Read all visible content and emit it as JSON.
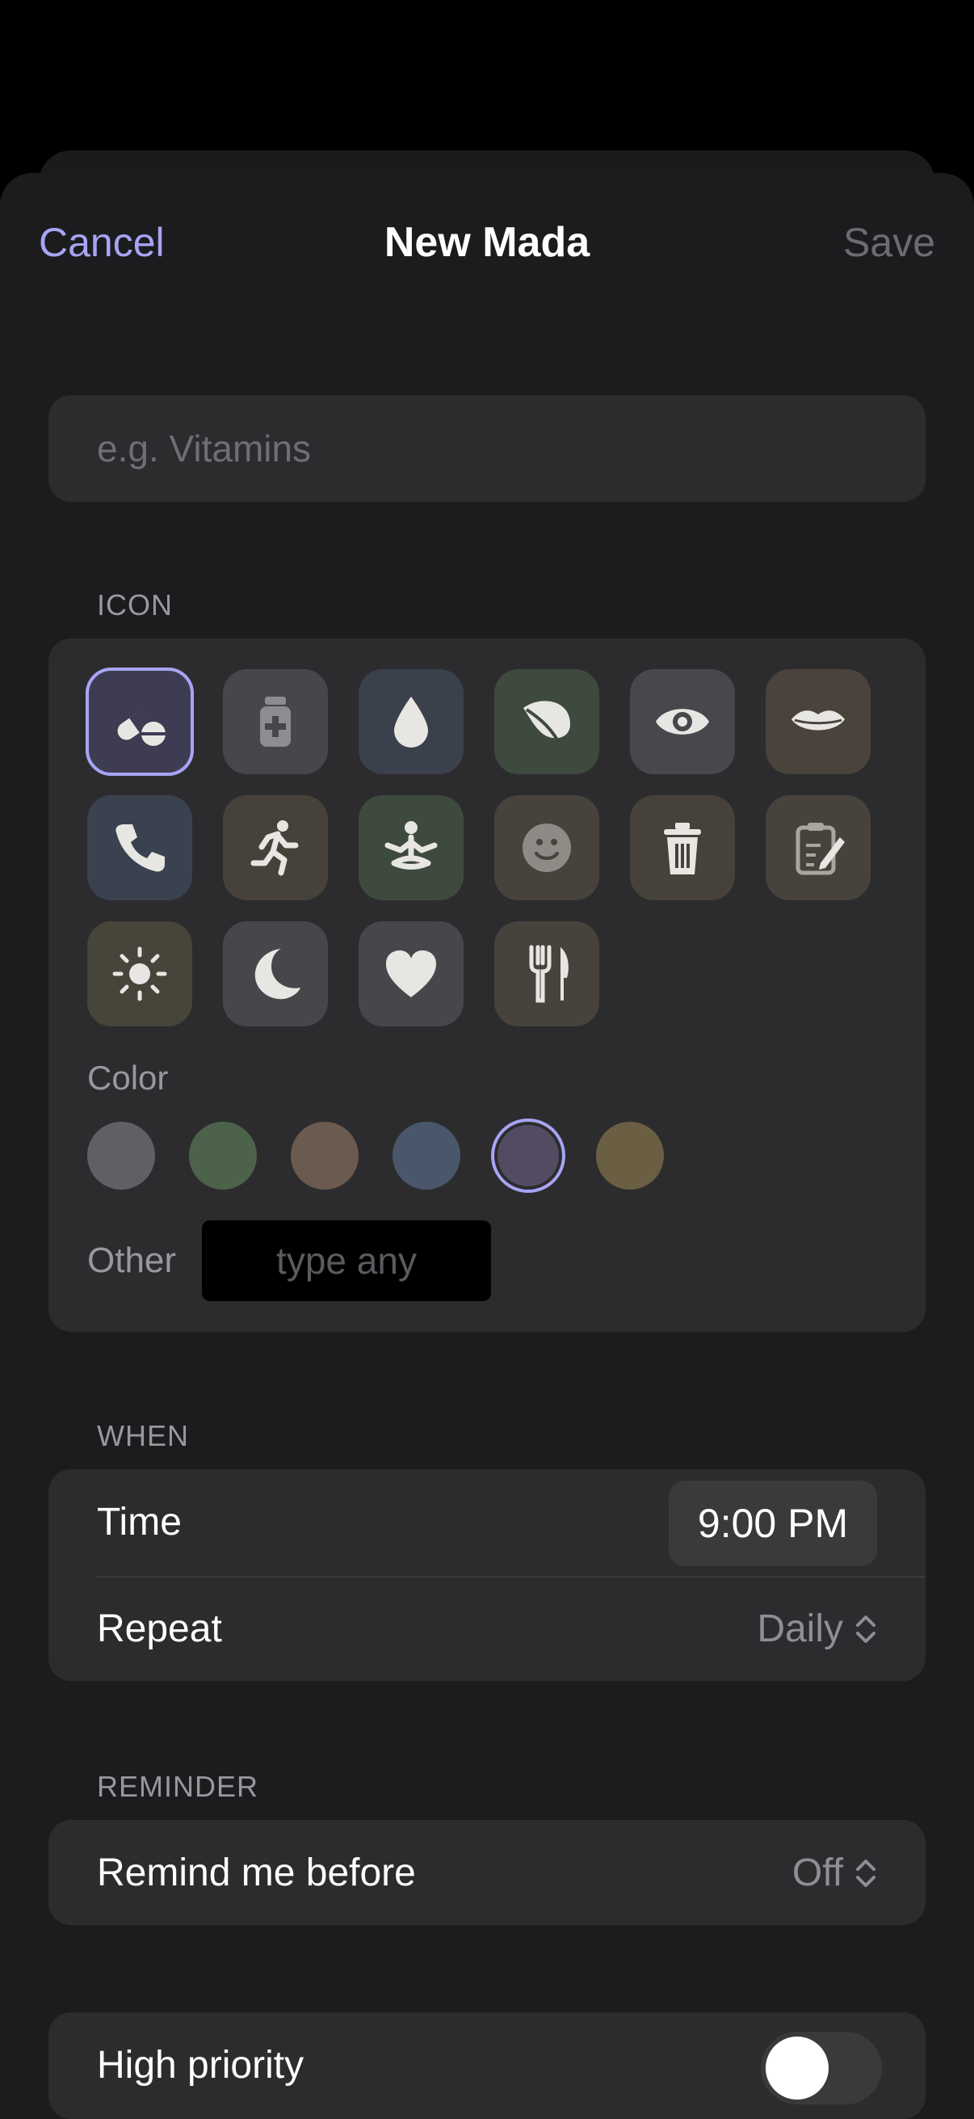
{
  "nav": {
    "cancel": "Cancel",
    "title": "New Mada",
    "save": "Save"
  },
  "name_field": {
    "placeholder": "e.g. Vitamins",
    "value": ""
  },
  "icon_section": {
    "label": "ICON",
    "icons": [
      {
        "name": "pills-icon",
        "bg": "#3e3c52",
        "selected": true
      },
      {
        "name": "medicine-bottle-icon",
        "bg": "#48464b"
      },
      {
        "name": "drop-icon",
        "bg": "#3a404c"
      },
      {
        "name": "leaf-icon",
        "bg": "#3d4a3d"
      },
      {
        "name": "eye-icon",
        "bg": "#48484c"
      },
      {
        "name": "lips-icon",
        "bg": "#4a433c"
      },
      {
        "name": "phone-icon",
        "bg": "#3a424f"
      },
      {
        "name": "runner-icon",
        "bg": "#46423a"
      },
      {
        "name": "meditation-icon",
        "bg": "#3d4a3d"
      },
      {
        "name": "smiley-icon",
        "bg": "#47423c"
      },
      {
        "name": "trash-icon",
        "bg": "#46423a"
      },
      {
        "name": "clipboard-icon",
        "bg": "#47423c"
      },
      {
        "name": "sun-icon",
        "bg": "#47443a"
      },
      {
        "name": "moon-icon",
        "bg": "#48464b"
      },
      {
        "name": "heart-icon",
        "bg": "#48464b"
      },
      {
        "name": "fork-knife-icon",
        "bg": "#47423c"
      }
    ],
    "color_label": "Color",
    "colors": [
      "#5f5f66",
      "#4d624b",
      "#6a5a4f",
      "#4a566a",
      "#534b62",
      "#6a5f42"
    ],
    "selected_color": 4,
    "other_label": "Other",
    "other_placeholder": "type any"
  },
  "when_section": {
    "label": "WHEN",
    "time_label": "Time",
    "time_value": "9:00 PM",
    "repeat_label": "Repeat",
    "repeat_value": "Daily"
  },
  "reminder_section": {
    "label": "REMINDER",
    "remind_label": "Remind me before",
    "remind_value": "Off"
  },
  "priority": {
    "label": "High priority",
    "enabled": false
  }
}
